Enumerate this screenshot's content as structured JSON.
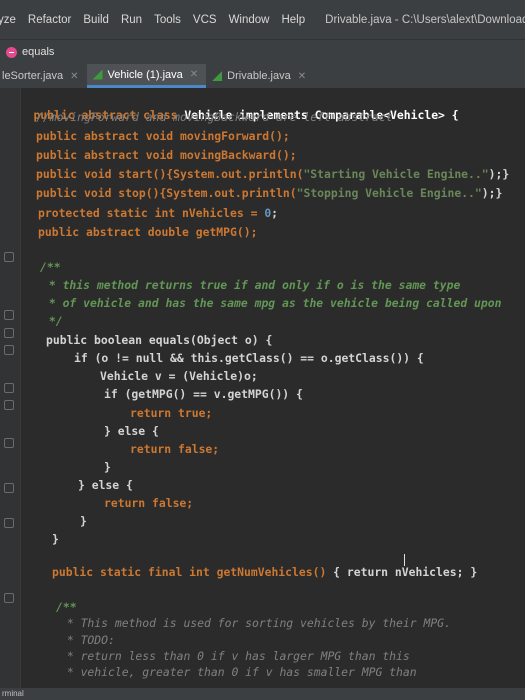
{
  "menubar": {
    "items": [
      "yze",
      "Refactor",
      "Build",
      "Run",
      "Tools",
      "VCS",
      "Window",
      "Help"
    ],
    "window_title": "Drivable.java - C:\\Users\\alext\\Downloads\\Ve"
  },
  "run_config": {
    "label": "equals"
  },
  "tabs": [
    {
      "label": "leSorter.java",
      "active": false
    },
    {
      "label": "Vehicle (1).java",
      "active": true
    },
    {
      "label": "Drivable.java",
      "active": false
    }
  ],
  "code": {
    "l1": "public abstract class Vehicle implements Comparable<Vehicle> {",
    "l2": "//movingForward and movingBackward are left abstract",
    "l3": "public abstract void movingForward();",
    "l4": "public abstract void movingBackward();",
    "l5a": "public void start(){System.out.println(",
    "l5s": "\"Starting Vehicle Engine..\"",
    "l5b": ");}",
    "l6a": "public void stop(){System.out.println(",
    "l6s": "\"Stopping Vehicle Engine..\"",
    "l6b": ");}",
    "l7a": "protected static int nVehicles = ",
    "l7n": "0",
    "l7b": ";",
    "l8": "public abstract double getMPG();",
    "d1": "/**",
    "d2": " * this method returns true if and only if o is the same type",
    "d3": " * of vehicle and has the same mpg as the vehicle being called upon",
    "d4": " */",
    "e1": "public boolean equals(Object o) {",
    "e2": "if (o != null && this.getClass() == o.getClass()) {",
    "e3": "Vehicle v = (Vehicle)o;",
    "e4": "if (getMPG() == v.getMPG()) {",
    "e5": "return true;",
    "e6": "} else {",
    "e7": "return false;",
    "e8": "}",
    "e9": "} else {",
    "e10": "return false;",
    "e11": "}",
    "e12": "}",
    "g1a": "public static final int getNumVehicles() ",
    "g1b": "{ return nVehicles; }",
    "c1": "/**",
    "c2": " * This method is used for sorting vehicles by their MPG.",
    "c3": " * TODO:",
    "c4": " * return less than 0 if v has larger MPG than this",
    "c5": " * vehicle, greater than 0 if v has smaller MPG than"
  },
  "bottom": {
    "label": "rminal"
  }
}
